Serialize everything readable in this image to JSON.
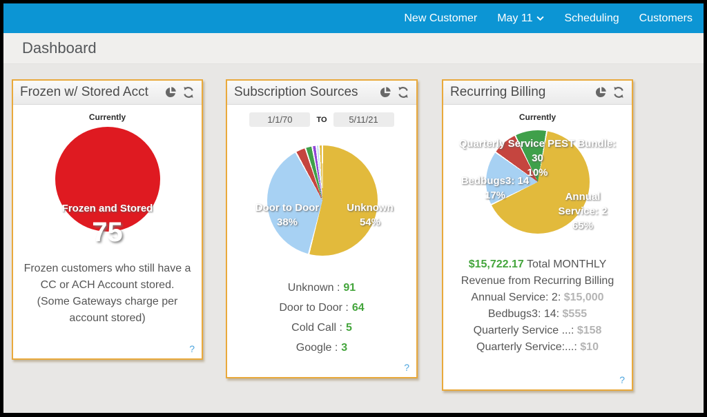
{
  "nav": {
    "new_customer": "New Customer",
    "date_menu": "May 11",
    "scheduling": "Scheduling",
    "customers": "Customers"
  },
  "page": {
    "title": "Dashboard"
  },
  "card_frozen": {
    "title": "Frozen w/ Stored Acct",
    "subtitle": "Currently",
    "circle_label": "Frozen and Stored",
    "circle_value": "75",
    "description": "Frozen customers who still have a CC or ACH Account stored. (Some Gateways charge per account stored)",
    "help_label": "?"
  },
  "card_sources": {
    "title": "Subscription Sources",
    "date_from": "1/1/70",
    "date_separator": "TO",
    "date_to": "5/11/21",
    "slice_label_door": "Door to Door",
    "slice_pct_door": "38%",
    "slice_label_unknown": "Unknown",
    "slice_pct_unknown": "54%",
    "legend": [
      {
        "label": "Unknown :",
        "value": "91"
      },
      {
        "label": "Door to Door :",
        "value": "64"
      },
      {
        "label": "Cold Call :",
        "value": "5"
      },
      {
        "label": "Google :",
        "value": "3"
      }
    ],
    "help_label": "?"
  },
  "card_billing": {
    "title": "Recurring Billing",
    "subtitle": "Currently",
    "label_quarterly_line1": "Quarterly Service PEST Bundle:",
    "label_quarterly_line2": "30",
    "label_quarterly_line3": "10%",
    "label_bedbugs": "Bedbugs3: 14",
    "pct_bedbugs": "17%",
    "label_annual": "Annual Service: 2",
    "pct_annual": "65%",
    "total_value": "$15,722.17",
    "total_suffix": "Total MONTHLY",
    "total_line2": "Revenue from Recurring Billing",
    "items": [
      {
        "label": "Annual Service: 2:",
        "value": "$15,000"
      },
      {
        "label": "Bedbugs3: 14:",
        "value": "$555"
      },
      {
        "label": "Quarterly Service ...:",
        "value": "$158"
      },
      {
        "label": "Quarterly Service:...:",
        "value": "$10"
      }
    ],
    "help_label": "?"
  },
  "colors": {
    "nav_blue": "#0c95d4",
    "card_border_orange": "#e9a93b",
    "frozen_red": "#df1a21",
    "pie_yellow": "#e2ba3c",
    "pie_light_blue": "#a7d1f3",
    "pie_red": "#c5453f",
    "pie_green": "#3fa04a",
    "pie_purple": "#9146d8",
    "value_green": "#44a53c",
    "money_gray": "#b4b4b4",
    "help_blue": "#4da5de"
  },
  "chart_data": [
    {
      "type": "pie",
      "title": "Frozen w/ Stored Acct (Currently)",
      "start_angle": 0,
      "gap": false,
      "slices": [
        {
          "label": "Frozen and Stored",
          "value": 75,
          "pct": 100,
          "color": "#df1a21"
        }
      ]
    },
    {
      "type": "pie",
      "title": "Subscription Sources",
      "date_range": [
        "1/1/70",
        "5/11/21"
      ],
      "start_angle": 0,
      "gap": true,
      "legend_position": "below",
      "slices": [
        {
          "label": "Unknown",
          "value": 91,
          "pct": 54,
          "color": "#e2ba3c"
        },
        {
          "label": "Door to Door",
          "value": 64,
          "pct": 38,
          "color": "#a7d1f3"
        },
        {
          "label": "Cold Call",
          "value": 5,
          "pct": 3,
          "color": "#c5453f"
        },
        {
          "label": "Google",
          "value": 3,
          "pct": 2,
          "color": "#3fa04a"
        },
        {
          "label": "other",
          "pct": 1.2,
          "color": "#9146d8"
        },
        {
          "label": "other",
          "pct": 0.8,
          "color": "#b9d9f2"
        },
        {
          "label": "other",
          "pct": 1.0,
          "color": "#e2ba3c"
        }
      ]
    },
    {
      "type": "pie",
      "title": "Recurring Billing (Currently)",
      "start_angle": 10,
      "gap": true,
      "slices": [
        {
          "label": "Annual Service: 2",
          "pct": 65,
          "monthly_revenue": "$15,000",
          "color": "#e2ba3c"
        },
        {
          "label": "Bedbugs3: 14",
          "pct": 17,
          "monthly_revenue": "$555",
          "color": "#a7d1f3"
        },
        {
          "label": "Quarterly Service ...",
          "pct": 8,
          "monthly_revenue": "$158",
          "color": "#c5453f"
        },
        {
          "label": "Quarterly Service PEST Bundle: 30",
          "pct": 10,
          "monthly_revenue": "$10",
          "color": "#3fa04a"
        }
      ],
      "total_monthly": "$15,722.17"
    }
  ]
}
